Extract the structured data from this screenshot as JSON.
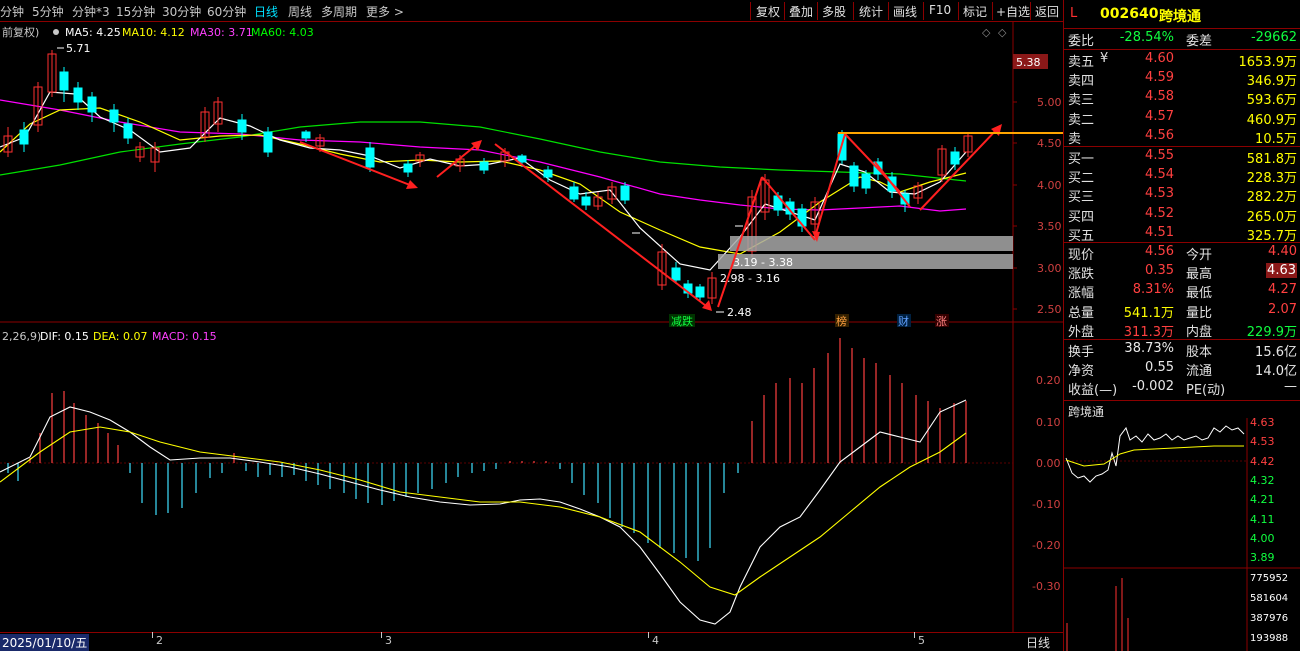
{
  "toolbar": {
    "timeframes": [
      "分钟",
      "5分钟",
      "分钟*3",
      "15分钟",
      "30分钟",
      "60分钟",
      "日线",
      "周线",
      "多周期",
      "更多 >"
    ],
    "active_timeframe": "日线",
    "right_buttons": [
      "复权",
      "叠加",
      "多股",
      "统计",
      "画线",
      "F10",
      "标记",
      "+自选",
      "返回"
    ]
  },
  "main": {
    "ma_legend": {
      "prefix": "前复权)",
      "ma5": "MA5: 4.25",
      "ma10": "MA10: 4.12",
      "ma30": "MA30: 3.71",
      "ma60": "MA60: 4.03"
    },
    "y_axis": [
      "5.38",
      "5.00",
      "4.50",
      "4.00",
      "3.50",
      "3.00",
      "2.50"
    ],
    "current_price_tag": "5.38",
    "high_label": "5.71",
    "low_label": "2.48",
    "zone_labels": [
      "3.19 - 3.38",
      "2.98 - 3.16"
    ],
    "event_tags": [
      "减跌",
      "榜",
      "财",
      "涨"
    ],
    "corner_icons": [
      "diamond-icon",
      "diamond-icon"
    ]
  },
  "macd": {
    "legend": {
      "prefix": "2,26,9)",
      "dif": "DIF: 0.15",
      "dea": "DEA: 0.07",
      "macd": "MACD: 0.15"
    },
    "y_axis": [
      "0.20",
      "0.10",
      "0.00",
      "-0.10",
      "-0.20",
      "-0.30"
    ]
  },
  "datebar": {
    "current_date": "2025/01/10/五",
    "months": [
      "2",
      "3",
      "4",
      "5"
    ],
    "period_label": "日线"
  },
  "colors": {
    "ma5": "#ffffff",
    "ma10": "#ffff00",
    "ma30": "#ff00ff",
    "ma60": "#00ff00",
    "up": "#ff3030",
    "down": "#00ffff",
    "accent": "#ff3030"
  },
  "quote": {
    "code": "002640",
    "name": "跨境通",
    "flag": "L",
    "weibi_label": "委比",
    "weibi": "-28.54%",
    "weicha_label": "委差",
    "weicha": "-29662",
    "sell": [
      {
        "label": "卖五",
        "price": "4.60",
        "vol": "1653.9万",
        "mark": "¥"
      },
      {
        "label": "卖四",
        "price": "4.59",
        "vol": "346.9万",
        "mark": ""
      },
      {
        "label": "卖三",
        "price": "4.58",
        "vol": "593.6万",
        "mark": ""
      },
      {
        "label": "卖二",
        "price": "4.57",
        "vol": "460.9万",
        "mark": ""
      },
      {
        "label": "卖",
        "price": "4.56",
        "vol": "10.5万",
        "mark": ""
      }
    ],
    "buy": [
      {
        "label": "买一",
        "price": "4.55",
        "vol": "581.8万"
      },
      {
        "label": "买二",
        "price": "4.54",
        "vol": "228.3万"
      },
      {
        "label": "买三",
        "price": "4.53",
        "vol": "282.2万"
      },
      {
        "label": "买四",
        "price": "4.52",
        "vol": "265.0万"
      },
      {
        "label": "买五",
        "price": "4.51",
        "vol": "325.7万"
      }
    ],
    "stats": [
      {
        "l1": "现价",
        "v1": "4.56",
        "c1": "red",
        "l2": "今开",
        "v2": "4.40",
        "c2": "red"
      },
      {
        "l1": "涨跌",
        "v1": "0.35",
        "c1": "red",
        "l2": "最高",
        "v2": "4.63",
        "c2": "red"
      },
      {
        "l1": "涨幅",
        "v1": "8.31%",
        "c1": "red",
        "l2": "最低",
        "v2": "4.27",
        "c2": "red"
      },
      {
        "l1": "总量",
        "v1": "541.1万",
        "c1": "yellow",
        "l2": "量比",
        "v2": "2.07",
        "c2": "red"
      },
      {
        "l1": "外盘",
        "v1": "311.3万",
        "c1": "red",
        "l2": "内盘",
        "v2": "229.9万",
        "c2": "green"
      }
    ],
    "stats2": [
      {
        "l1": "换手",
        "v1": "38.73%",
        "l2": "股本",
        "v2": "15.6亿"
      },
      {
        "l1": "净资",
        "v1": "0.55",
        "l2": "流通",
        "v2": "14.0亿"
      },
      {
        "l1": "收益(—)",
        "v1": "-0.002",
        "l2": "PE(动)",
        "v2": "—"
      }
    ]
  },
  "mini": {
    "title": "跨境通",
    "price_axis": [
      "4.63",
      "4.53",
      "4.42",
      "4.32",
      "4.21",
      "4.11",
      "4.00",
      "3.89"
    ],
    "vol_axis": [
      "775952",
      "581604",
      "387976",
      "193988"
    ]
  }
}
